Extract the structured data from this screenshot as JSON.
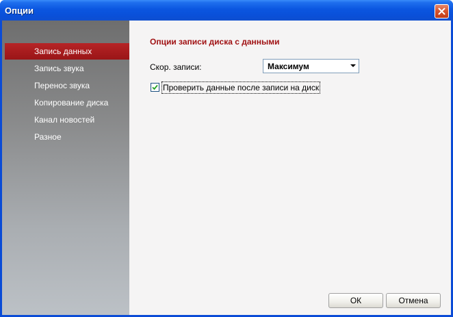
{
  "window": {
    "title": "Опции",
    "close_icon": "close-icon"
  },
  "sidebar": {
    "items": [
      {
        "label": "Запись данных",
        "active": true
      },
      {
        "label": "Запись звука",
        "active": false
      },
      {
        "label": "Перенос звука",
        "active": false
      },
      {
        "label": "Копирование диска",
        "active": false
      },
      {
        "label": "Канал новостей",
        "active": false
      },
      {
        "label": "Разное",
        "active": false
      }
    ]
  },
  "content": {
    "title": "Опции записи диска с данными",
    "speed_label": "Скор. записи:",
    "speed_value": "Максимум",
    "verify_checked": true,
    "verify_label": "Проверить данные после записи на диск"
  },
  "buttons": {
    "ok": "ОК",
    "cancel": "Отмена"
  },
  "colors": {
    "accent": "#a01214",
    "active_item": "#b62426",
    "titlebar": "#0b56e0"
  }
}
